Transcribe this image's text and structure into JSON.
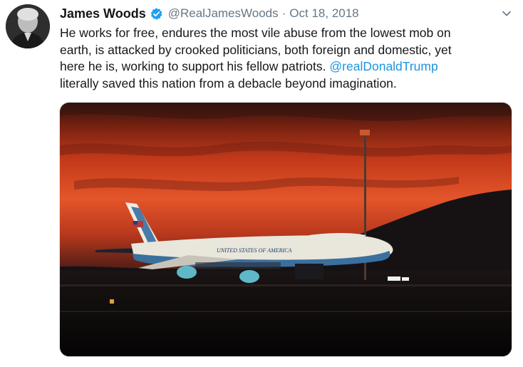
{
  "tweet": {
    "author_name": "James Woods",
    "handle": "@RealJamesWoods",
    "separator": "·",
    "date": "Oct 18, 2018",
    "text_part1": "He works for free, endures the most vile abuse from the lowest mob on\nearth, is attacked by crooked politicians, both foreign and domestic, yet\nhere he is, working to support his fellow patriots. ",
    "mention": "@realDonaldTrump",
    "text_part2": "\n literally saved this nation from a debacle beyond imagination."
  },
  "media": {
    "fuselage_text": "UNITED STATES OF AMERICA",
    "description_icon": "photo"
  },
  "colors": {
    "link": "#1b95e0",
    "secondary_text": "#657786",
    "verified": "#1da1f2"
  }
}
